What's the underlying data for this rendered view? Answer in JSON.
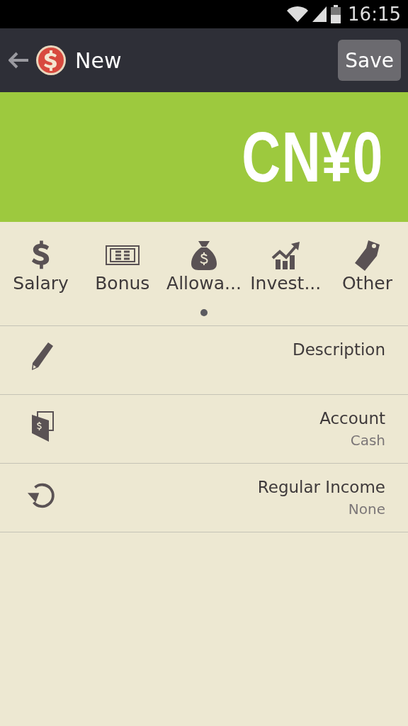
{
  "status_bar": {
    "time": "16:15"
  },
  "app_bar": {
    "title": "New",
    "action": "Save"
  },
  "amount": "CN¥0",
  "categories": [
    {
      "kind": "dollar",
      "label": "Salary"
    },
    {
      "kind": "bill",
      "label": "Bonus"
    },
    {
      "kind": "bag",
      "label": "Allowa..."
    },
    {
      "kind": "chart",
      "label": "Invest..."
    },
    {
      "kind": "tag",
      "label": "Other"
    }
  ],
  "pager": [
    {
      "selected": true
    }
  ],
  "fields": [
    {
      "kind": "pencil",
      "label": "Description"
    },
    {
      "kind": "wallet",
      "label": "Account",
      "value": "Cash"
    },
    {
      "kind": "repeat",
      "label": "Regular Income",
      "value": "None"
    }
  ]
}
